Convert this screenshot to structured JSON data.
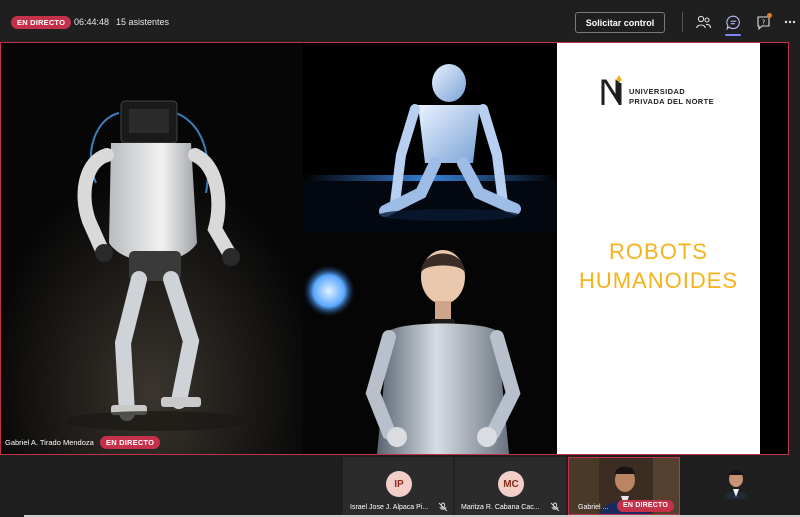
{
  "topbar": {
    "live_label": "EN DIRECTO",
    "timer": "06:44:48",
    "attendees": "15 asistentes",
    "request_control_label": "Solicitar control",
    "icons": [
      "people-icon",
      "chat-icon",
      "help-icon",
      "more-icon"
    ]
  },
  "stage": {
    "slide": {
      "logo_line1": "UNIVERSIDAD",
      "logo_line2": "PRIVADA DEL NORTE",
      "logo_letter": "N",
      "title_line1": "ROBOTS",
      "title_line2": "HUMANOIDES",
      "title_color": "#f5b31b"
    },
    "presenter_name": "Gabriel A. Tirado Mendoza",
    "presenter_live_label": "EN DIRECTO"
  },
  "participants": [
    {
      "initials": "IP",
      "name": "Israel Jose J. Alpaca Pi..."
    },
    {
      "initials": "MC",
      "name": "Maritza R. Cabana Cac..."
    },
    {
      "initials": "",
      "name": "Gabriel ...",
      "live_label": "EN DIRECTO"
    }
  ],
  "colors": {
    "accent_live": "#c4314b",
    "avatar_bg": "#f2d0c9",
    "avatar_fg": "#8a2b1b",
    "chat_active": "#7f85f5"
  }
}
